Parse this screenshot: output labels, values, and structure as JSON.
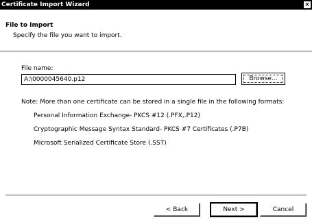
{
  "window": {
    "title": "Certificate Import Wizard",
    "close_glyph": "×"
  },
  "header": {
    "title": "File to Import",
    "subtitle": "Specify the file you want to import."
  },
  "form": {
    "file_name_label": "File name:",
    "file_name_value": "A:\\0000045640.p12",
    "browse_label": "Browse..."
  },
  "note": {
    "text": "Note:  More than one certificate can be stored in a single file in the following formats:",
    "formats": [
      "Personal Information Exchange- PKCS #12 (.PFX,.P12)",
      "Cryptographic Message Syntax Standard- PKCS #7 Certificates (.P7B)",
      "Microsoft Serialized Certificate Store (.SST)"
    ]
  },
  "footer": {
    "back_label": "< Back",
    "next_label": "Next >",
    "cancel_label": "Cancel"
  }
}
